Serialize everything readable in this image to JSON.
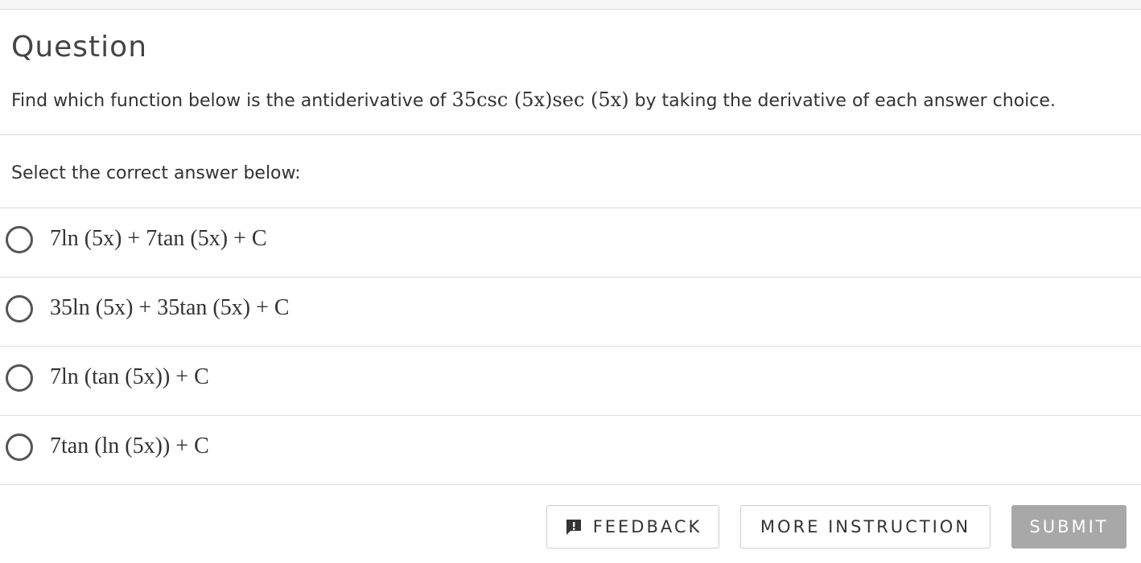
{
  "heading": "Question",
  "prompt": {
    "before": "Find which function below is the antiderivative of",
    "expression": "35csc (5x)sec (5x)",
    "after": "by taking the derivative of each answer choice."
  },
  "instruction": "Select the correct answer below:",
  "options": [
    {
      "label": "7ln (5x) + 7tan (5x) + C",
      "selected": false
    },
    {
      "label": "35ln (5x) + 35tan (5x) + C",
      "selected": false
    },
    {
      "label": "7ln (tan (5x)) + C",
      "selected": false
    },
    {
      "label": "7tan (ln (5x)) + C",
      "selected": false
    }
  ],
  "buttons": {
    "feedback": "FEEDBACK",
    "more_instruction": "MORE INSTRUCTION",
    "submit": "SUBMIT"
  },
  "icons": {
    "feedback": "feedback-icon",
    "radio": "radio-unchecked-icon"
  },
  "colors": {
    "submit_disabled_bg": "#a8a8a8",
    "text": "#333333"
  }
}
